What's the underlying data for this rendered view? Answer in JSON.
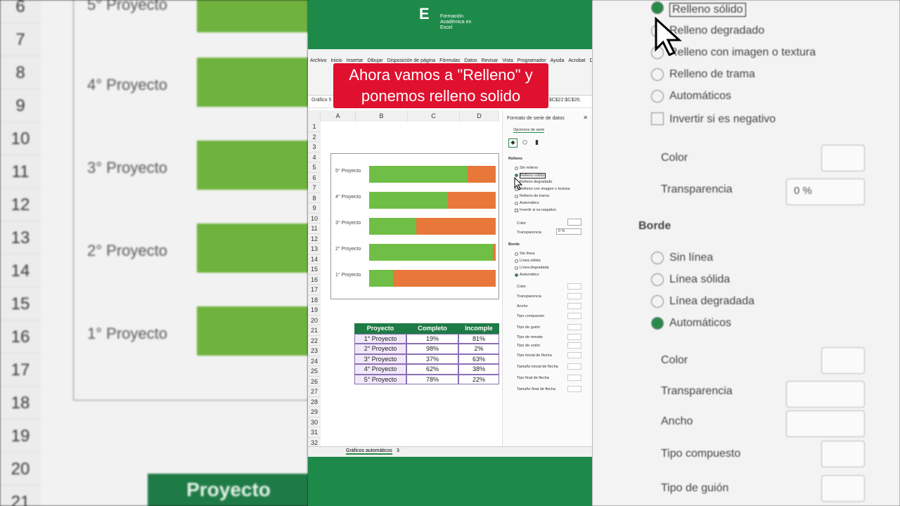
{
  "left_bg": {
    "rows": [
      "6",
      "7",
      "8",
      "9",
      "10",
      "11",
      "12",
      "13",
      "14",
      "15",
      "16",
      "17",
      "18",
      "19",
      "20",
      "21"
    ],
    "labels": [
      "5° Proyecto",
      "4° Proyecto",
      "3° Proyecto",
      "2° Proyecto",
      "1° Proyecto"
    ],
    "table_header": "Proyecto"
  },
  "right_bg": {
    "fill_items": [
      "Relleno sólido",
      "Relleno degradado",
      "Relleno con imagen o textura",
      "Relleno de trama",
      "Automáticos",
      "Invertir si es negativo"
    ],
    "color_label": "Color",
    "transparency_label": "Transparencia",
    "transparency_value": "0 %",
    "border_header": "Borde",
    "border_items": [
      "Sin línea",
      "Línea sólida",
      "Línea degradada",
      "Automáticos"
    ],
    "border_color": "Color",
    "border_transparency": "Transparencia",
    "width_label": "Ancho",
    "compound_label": "Tipo compuesto",
    "dash_label": "Tipo de guión"
  },
  "logo": {
    "line1": "Formación",
    "line2": "Académica en",
    "line3": "Excel"
  },
  "ribbon": {
    "tabs": [
      "Archivo",
      "Inicio",
      "Insertar",
      "Dibujar",
      "Disposición de página",
      "Fórmulas",
      "Datos",
      "Revisar",
      "Vista",
      "Programador",
      "Ayuda",
      "Acrobat",
      "Diseño de gráfico"
    ]
  },
  "formula_bar": {
    "name_box": "Gráfico 5",
    "formula": "$C$22:$C$26;"
  },
  "overlay": {
    "line1": "Ahora vamos a \"Relleno\" y",
    "line2": "ponemos relleno solido"
  },
  "grid": {
    "cols": [
      "A",
      "B",
      "C",
      "D"
    ],
    "rows": [
      "1",
      "2",
      "3",
      "4",
      "5",
      "6",
      "7",
      "8",
      "9",
      "10",
      "11",
      "12",
      "13",
      "14",
      "15",
      "16",
      "17",
      "18",
      "19",
      "20",
      "21",
      "22",
      "23",
      "24",
      "25",
      "26",
      "27",
      "28",
      "29",
      "30",
      "31",
      "32"
    ]
  },
  "chart_data": {
    "type": "bar",
    "categories": [
      "5° Proyecto",
      "4° Proyecto",
      "3° Proyecto",
      "2° Proyecto",
      "1° Proyecto"
    ],
    "series": [
      {
        "name": "Completo",
        "values": [
          78,
          62,
          37,
          98,
          19
        ]
      },
      {
        "name": "Incompleto",
        "values": [
          22,
          38,
          63,
          2,
          81
        ]
      }
    ],
    "colors": [
      "#6fbe45",
      "#e8783a"
    ]
  },
  "table": {
    "headers": [
      "Proyecto",
      "Completo",
      "Incomple"
    ],
    "rows": [
      [
        "1° Proyecto",
        "19%",
        "81%"
      ],
      [
        "2° Proyecto",
        "98%",
        "2%"
      ],
      [
        "3° Proyecto",
        "37%",
        "63%"
      ],
      [
        "4° Proyecto",
        "62%",
        "38%"
      ],
      [
        "5° Proyecto",
        "78%",
        "22%"
      ]
    ]
  },
  "panel": {
    "title": "Formato de serie de datos",
    "subtitle": "Opciones de serie",
    "fill_header": "Relleno",
    "fill_items": [
      "Sin relleno",
      "Relleno sólido",
      "Relleno degradado",
      "Relleno con imagen o textura",
      "Relleno de trama",
      "Automático",
      "Invertir si es negativo"
    ],
    "color": "Color",
    "transparency": "Transparencia",
    "transparency_value": "0 %",
    "border_header": "Borde",
    "border_items": [
      "Sin línea",
      "Línea sólida",
      "Línea degradada",
      "Automático"
    ],
    "b_color": "Color",
    "b_transp": "Transparencia",
    "b_width": "Ancho",
    "b_compound": "Tipo compuesto",
    "b_dash": "Tipo de guión",
    "b_cap": "Tipo de remate",
    "b_join": "Tipo de unión",
    "b_start": "Tipo inicial de flecha",
    "b_start_size": "Tamaño inicial de flecha",
    "b_end": "Tipo final de flecha",
    "b_end_size": "Tamaño final de flecha"
  },
  "sheet": {
    "tab": "Gráficos automáticos",
    "count": "3"
  }
}
